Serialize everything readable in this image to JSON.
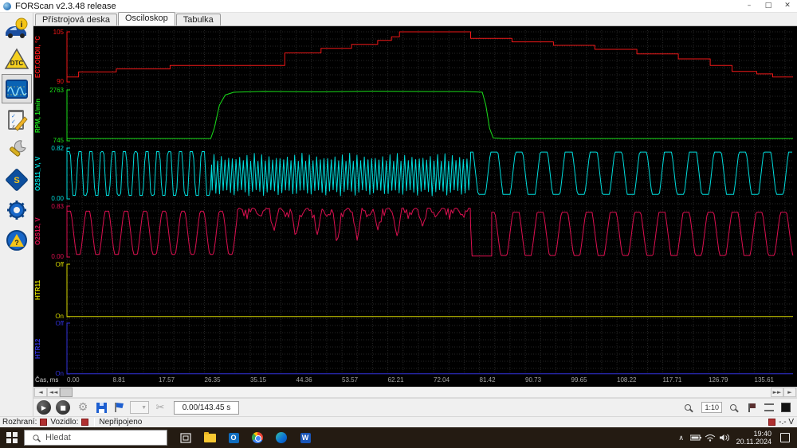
{
  "window": {
    "title": "FORScan v2.3.48 release",
    "minimize": "–",
    "maximize": "□",
    "close": "✕"
  },
  "tabs": [
    {
      "label": "Přístrojová deska",
      "active": false
    },
    {
      "label": "Osciloskop",
      "active": true
    },
    {
      "label": "Tabulka",
      "active": false
    }
  ],
  "sidebar_items": [
    "vehicle-info",
    "dtc",
    "oscilloscope",
    "tests",
    "service",
    "configuration",
    "settings",
    "about"
  ],
  "scope": {
    "time_label": "Čas, ms",
    "time_ticks": [
      "0.00",
      "8.81",
      "17.57",
      "26.35",
      "35.15",
      "44.36",
      "53.57",
      "62.21",
      "72.04",
      "81.42",
      "90.73",
      "99.65",
      "108.22",
      "117.71",
      "126.79",
      "135.61"
    ],
    "grid_color": "#262626",
    "channels": [
      {
        "name": "ECT.OBDII, °C",
        "color": "#f01818",
        "top_label": "105",
        "bottom_label": "90",
        "trace": [
          {
            "type": "steps",
            "pts": [
              [
                0,
                0.1
              ],
              [
                0.016,
                0.2
              ],
              [
                0.068,
                0.26
              ],
              [
                0.142,
                0.33
              ],
              [
                0.3,
                0.58
              ],
              [
                0.35,
                0.67
              ],
              [
                0.392,
                0.75
              ],
              [
                0.428,
                0.83
              ],
              [
                0.447,
                0.9
              ],
              [
                0.458,
                1.0
              ],
              [
                0.545,
                1.0
              ],
              [
                0.556,
                0.87
              ],
              [
                0.613,
                0.8
              ],
              [
                0.67,
                0.73
              ],
              [
                0.727,
                0.65
              ],
              [
                0.785,
                0.56
              ],
              [
                0.842,
                0.46
              ],
              [
                0.886,
                0.33
              ],
              [
                0.916,
                0.21
              ],
              [
                0.95,
                0.16
              ],
              [
                0.972,
                0.1
              ],
              [
                1,
                0.1
              ]
            ]
          }
        ]
      },
      {
        "name": "RPM, 1/min",
        "color": "#1ae01a",
        "top_label": "2763",
        "bottom_label": "745",
        "trace": [
          {
            "type": "line",
            "pts": [
              [
                0,
                0.045
              ],
              [
                0.198,
                0.045
              ],
              [
                0.203,
                0.25
              ],
              [
                0.21,
                0.7
              ],
              [
                0.218,
                0.9
              ],
              [
                0.23,
                0.955
              ],
              [
                0.27,
                0.97
              ],
              [
                0.35,
                0.963
              ],
              [
                0.42,
                0.975
              ],
              [
                0.5,
                0.968
              ],
              [
                0.55,
                0.968
              ],
              [
                0.572,
                0.955
              ],
              [
                0.577,
                0.7
              ],
              [
                0.582,
                0.25
              ],
              [
                0.587,
                0.06
              ],
              [
                0.6,
                0.045
              ],
              [
                1,
                0.045
              ]
            ]
          }
        ]
      },
      {
        "name": "O2S11_V, V",
        "color": "#00dcdc",
        "top_label": "0.82",
        "bottom_label": "0.00",
        "trace": [
          {
            "type": "osc",
            "from": 0,
            "to": 0.2,
            "period": 0.0154,
            "min": 0.07,
            "max": 0.93,
            "clip": 1.7,
            "phase": 0.1
          },
          {
            "type": "dense",
            "from": 0.2,
            "to": 0.556,
            "step": 2.3,
            "min": 0.06,
            "max": 0.9
          },
          {
            "type": "osc",
            "from": 0.556,
            "to": 1.0,
            "period": 0.0342,
            "min": 0.09,
            "max": 0.92,
            "clip": 1.7,
            "phase": 0.3
          }
        ]
      },
      {
        "name": "O2S12, V",
        "color": "#dc1050",
        "top_label": "0.83",
        "bottom_label": "0.00",
        "trace": [
          {
            "type": "osc",
            "from": 0,
            "to": 0.235,
            "period": 0.0262,
            "min": 0.05,
            "max": 0.9,
            "clip": 1.25,
            "phase": 0.15
          },
          {
            "type": "fuzzy",
            "from": 0.235,
            "to": 0.556,
            "step": 2.0,
            "lo": 0.74,
            "hi": 0.96,
            "dips": [
              [
                0.285,
                0.5
              ],
              [
                0.315,
                0.35
              ],
              [
                0.345,
                0.42
              ],
              [
                0.372,
                0.22
              ],
              [
                0.4,
                0.3
              ],
              [
                0.428,
                0.52
              ],
              [
                0.455,
                0.38
              ],
              [
                0.49,
                0.6
              ]
            ]
          },
          {
            "type": "line",
            "pts": [
              [
                0.556,
                0.6
              ],
              [
                0.558,
                0.02
              ],
              [
                0.585,
                0.02
              ]
            ]
          },
          {
            "type": "osc",
            "from": 0.585,
            "to": 1.0,
            "period": 0.0335,
            "min": 0.03,
            "max": 0.88,
            "clip": 1.45,
            "phase": 0.25
          }
        ]
      },
      {
        "name": "HTR11",
        "color": "#d8d800",
        "top_label": "Off",
        "bottom_label": "On",
        "trace": [
          {
            "type": "line",
            "pts": [
              [
                0,
                0.005
              ],
              [
                1,
                0.005
              ]
            ]
          }
        ]
      },
      {
        "name": "HTR12",
        "color": "#3232dc",
        "top_label": "Off",
        "bottom_label": "On",
        "trace": [
          {
            "type": "line",
            "pts": [
              [
                0,
                0.005
              ],
              [
                1,
                0.005
              ]
            ]
          }
        ]
      }
    ]
  },
  "hscroll": {
    "left1": "◄",
    "left2": "◄◄",
    "right1": "►►",
    "right2": "►"
  },
  "toolbar": {
    "play": "▶",
    "stop": "■",
    "gear": "⚙",
    "cut": "✂",
    "combo_arrow": "▼",
    "position_text": "0.00/143.45 s",
    "zoom_scale": "1:10"
  },
  "statusbar": {
    "interface_label": "Rozhraní:",
    "vehicle_label": "Vozidlo:",
    "connection": "Nepřipojeno",
    "voltage": "-.- V"
  },
  "taskbar": {
    "search_placeholder": "Hledat",
    "outlook": "O",
    "word": "W",
    "chevron": "∧",
    "time": "19:40",
    "date": "20.11.2024"
  }
}
